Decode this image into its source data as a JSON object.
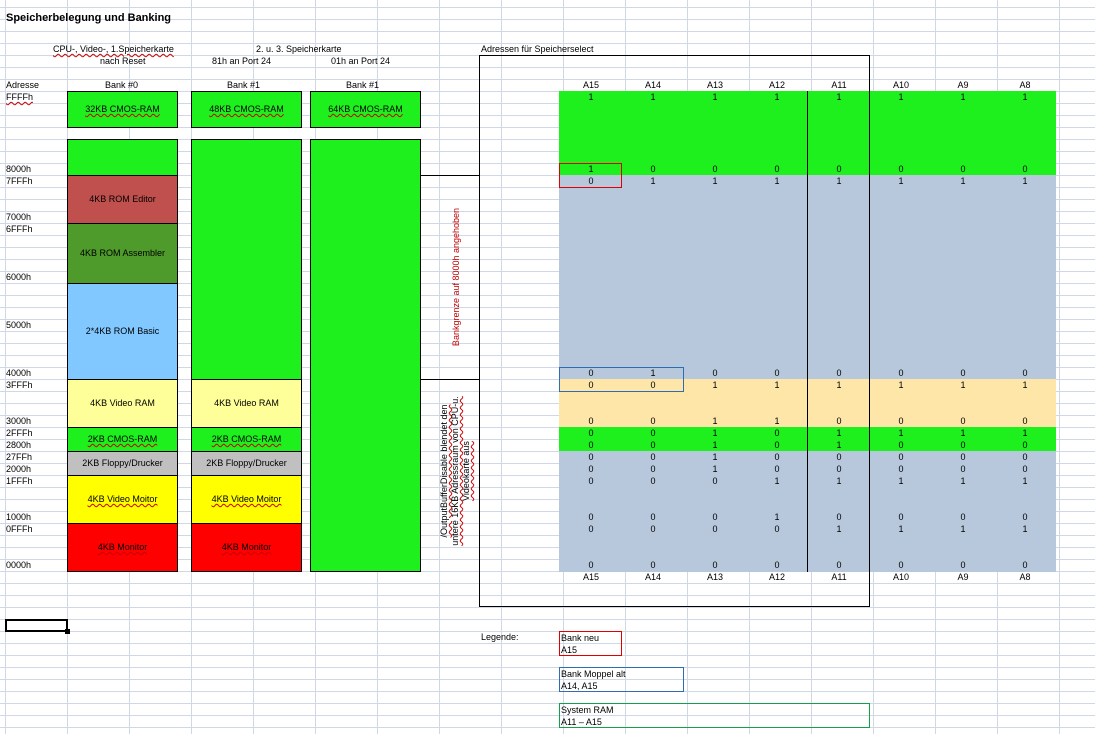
{
  "title": "Speicherbelegung und Banking",
  "headers": {
    "col1_line1": "CPU-, Video-, 1.Speicherkarte",
    "col1_line2": "nach Reset",
    "col23_line1": "2. u. 3. Speicherkarte",
    "col2_line2": "81h an Port 24",
    "col3_line2": "01h an Port 24",
    "adresse": "Adresse",
    "bank0": "Bank #0",
    "bank1a": "Bank #1",
    "bank1b": "Bank #1",
    "adressen_select": "Adressen für Speicherselect"
  },
  "address_labels": [
    "FFFFh",
    "8000h",
    "7FFFh",
    "7000h",
    "6FFFh",
    "6000h",
    "5000h",
    "4000h",
    "3FFFh",
    "3000h",
    "2FFFh",
    "2800h",
    "27FFh",
    "2000h",
    "1FFFh",
    "1000h",
    "0FFFh",
    "0000h"
  ],
  "bank0_blocks": [
    {
      "label": "32KB CMOS-RAM",
      "color": "#1ef01e"
    },
    {
      "label": "4KB ROM Editor",
      "color": "#c0504d"
    },
    {
      "label": "4KB ROM Assembler",
      "color": "#4e9a2a"
    },
    {
      "label": "2*4KB ROM Basic",
      "color": "#80c8ff"
    },
    {
      "label": "4KB Video RAM",
      "color": "#ffff99"
    },
    {
      "label": "2KB CMOS-RAM",
      "color": "#1ef01e"
    },
    {
      "label": "2KB Floppy/Drucker",
      "color": "#c0c0c0"
    },
    {
      "label": "4KB Video Moitor",
      "color": "#ffff00"
    },
    {
      "label": "4KB Monitor",
      "color": "#ff0000"
    }
  ],
  "bank1_blocks": [
    {
      "label": "48KB CMOS-RAM",
      "color": "#1ef01e"
    },
    {
      "label": "4KB Video RAM",
      "color": "#ffff99"
    },
    {
      "label": "2KB CMOS-RAM",
      "color": "#1ef01e"
    },
    {
      "label": "2KB Floppy/Drucker",
      "color": "#c0c0c0"
    },
    {
      "label": "4KB Video Moitor",
      "color": "#ffff00"
    },
    {
      "label": "4KB Monitor",
      "color": "#ff0000"
    }
  ],
  "bank1b_blocks": [
    {
      "label": "64KB CMOS-RAM",
      "color": "#1ef01e"
    }
  ],
  "notes": {
    "bankgrenze": "Bankgrenze auf 8000h angehoben",
    "output_line1": "/OutputBufferDisable blendet den",
    "output_line2": "untere 16KB Adressraum von CPU-u.",
    "output_line3": "Videokarte aus"
  },
  "bit_columns": [
    "A15",
    "A14",
    "A13",
    "A12",
    "A11",
    "A10",
    "A9",
    "A8"
  ],
  "bit_rows": [
    {
      "addr": "FFFFh",
      "bits": [
        "1",
        "1",
        "1",
        "1",
        "1",
        "1",
        "1",
        "1"
      ]
    },
    {
      "addr": "8000h",
      "bits": [
        "1",
        "0",
        "0",
        "0",
        "0",
        "0",
        "0",
        "0"
      ]
    },
    {
      "addr": "7FFFh",
      "bits": [
        "0",
        "1",
        "1",
        "1",
        "1",
        "1",
        "1",
        "1"
      ]
    },
    {
      "addr": "4000h",
      "bits": [
        "0",
        "1",
        "0",
        "0",
        "0",
        "0",
        "0",
        "0"
      ]
    },
    {
      "addr": "3FFFh",
      "bits": [
        "0",
        "0",
        "1",
        "1",
        "1",
        "1",
        "1",
        "1"
      ]
    },
    {
      "addr": "3000h",
      "bits": [
        "0",
        "0",
        "1",
        "1",
        "0",
        "0",
        "0",
        "0"
      ]
    },
    {
      "addr": "2FFFh",
      "bits": [
        "0",
        "0",
        "1",
        "0",
        "1",
        "1",
        "1",
        "1"
      ]
    },
    {
      "addr": "2800h",
      "bits": [
        "0",
        "0",
        "1",
        "0",
        "1",
        "0",
        "0",
        "0"
      ]
    },
    {
      "addr": "27FFh",
      "bits": [
        "0",
        "0",
        "1",
        "0",
        "0",
        "0",
        "0",
        "0"
      ]
    },
    {
      "addr": "2000h",
      "bits": [
        "0",
        "0",
        "1",
        "0",
        "0",
        "0",
        "0",
        "0"
      ]
    },
    {
      "addr": "1FFFh",
      "bits": [
        "0",
        "0",
        "0",
        "1",
        "1",
        "1",
        "1",
        "1"
      ]
    },
    {
      "addr": "1000h",
      "bits": [
        "0",
        "0",
        "0",
        "1",
        "0",
        "0",
        "0",
        "0"
      ]
    },
    {
      "addr": "0FFFh",
      "bits": [
        "0",
        "0",
        "0",
        "0",
        "1",
        "1",
        "1",
        "1"
      ]
    },
    {
      "addr": "0000h",
      "bits": [
        "0",
        "0",
        "0",
        "0",
        "0",
        "0",
        "0",
        "0"
      ]
    }
  ],
  "legend": {
    "label": "Legende:",
    "bank_neu": "Bank neu",
    "bank_neu_bits": "A15",
    "bank_moppel": "Bank Moppel alt",
    "bank_moppel_bits": "A14, A15",
    "system_ram": "System RAM",
    "system_ram_bits": "A11 – A15"
  },
  "colors": {
    "green": "#1ef01e",
    "blue_gray": "#b8c8dc",
    "peach": "#fde6a8",
    "legend_red": "#e00000",
    "legend_blue": "#2e6db4",
    "legend_green": "#12a04a"
  }
}
